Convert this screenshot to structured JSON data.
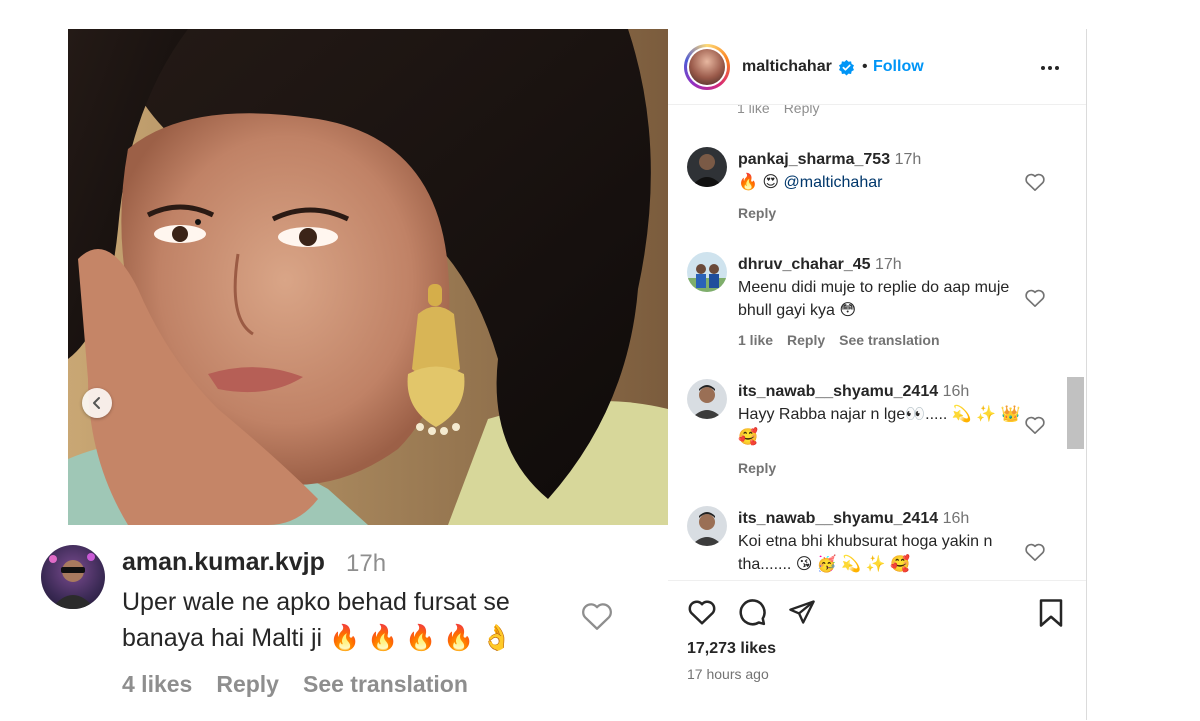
{
  "post": {
    "username": "maltichahar",
    "follow_label": "Follow",
    "dot": "•",
    "likes": "17,273 likes",
    "time_ago": "17 hours ago"
  },
  "cut_comment": {
    "likes": "1 like",
    "reply": "Reply"
  },
  "comments": [
    {
      "user": "pankaj_sharma_753",
      "time": "17h",
      "text_emoji": "🔥 😍",
      "mention": "@maltichahar",
      "reply": "Reply"
    },
    {
      "user": "dhruv_chahar_45",
      "time": "17h",
      "text": "Meenu didi muje to replie do aap muje bhull gayi kya 😳",
      "likes": "1 like",
      "reply": "Reply",
      "translate": "See translation"
    },
    {
      "user": "its_nawab__shyamu_2414",
      "time": "16h",
      "text": "Hayy Rabba najar n lge👀..... 💫 ✨ 👑 🥰",
      "reply": "Reply"
    },
    {
      "user": "its_nawab__shyamu_2414",
      "time": "16h",
      "text": "Koi etna bhi khubsurat hoga yakin n tha....... 😘 🥳 💫 ✨ 🥰"
    }
  ],
  "highlight_comment": {
    "user": "aman.kumar.kvjp",
    "time": "17h",
    "text": "Uper wale ne apko behad fursat se banaya hai Malti ji 🔥 🔥 🔥 🔥 👌",
    "likes": "4 likes",
    "reply": "Reply",
    "translate": "See translation"
  },
  "icons": {
    "like": "heart-icon",
    "comment": "comment-icon",
    "share": "share-icon",
    "save": "bookmark-icon",
    "more": "more-options-icon",
    "verified": "verified-badge-icon",
    "prev": "chevron-left-icon"
  },
  "colors": {
    "accent": "#0095f6",
    "text": "#262626",
    "muted": "#737373",
    "verified": "#0095f6"
  }
}
